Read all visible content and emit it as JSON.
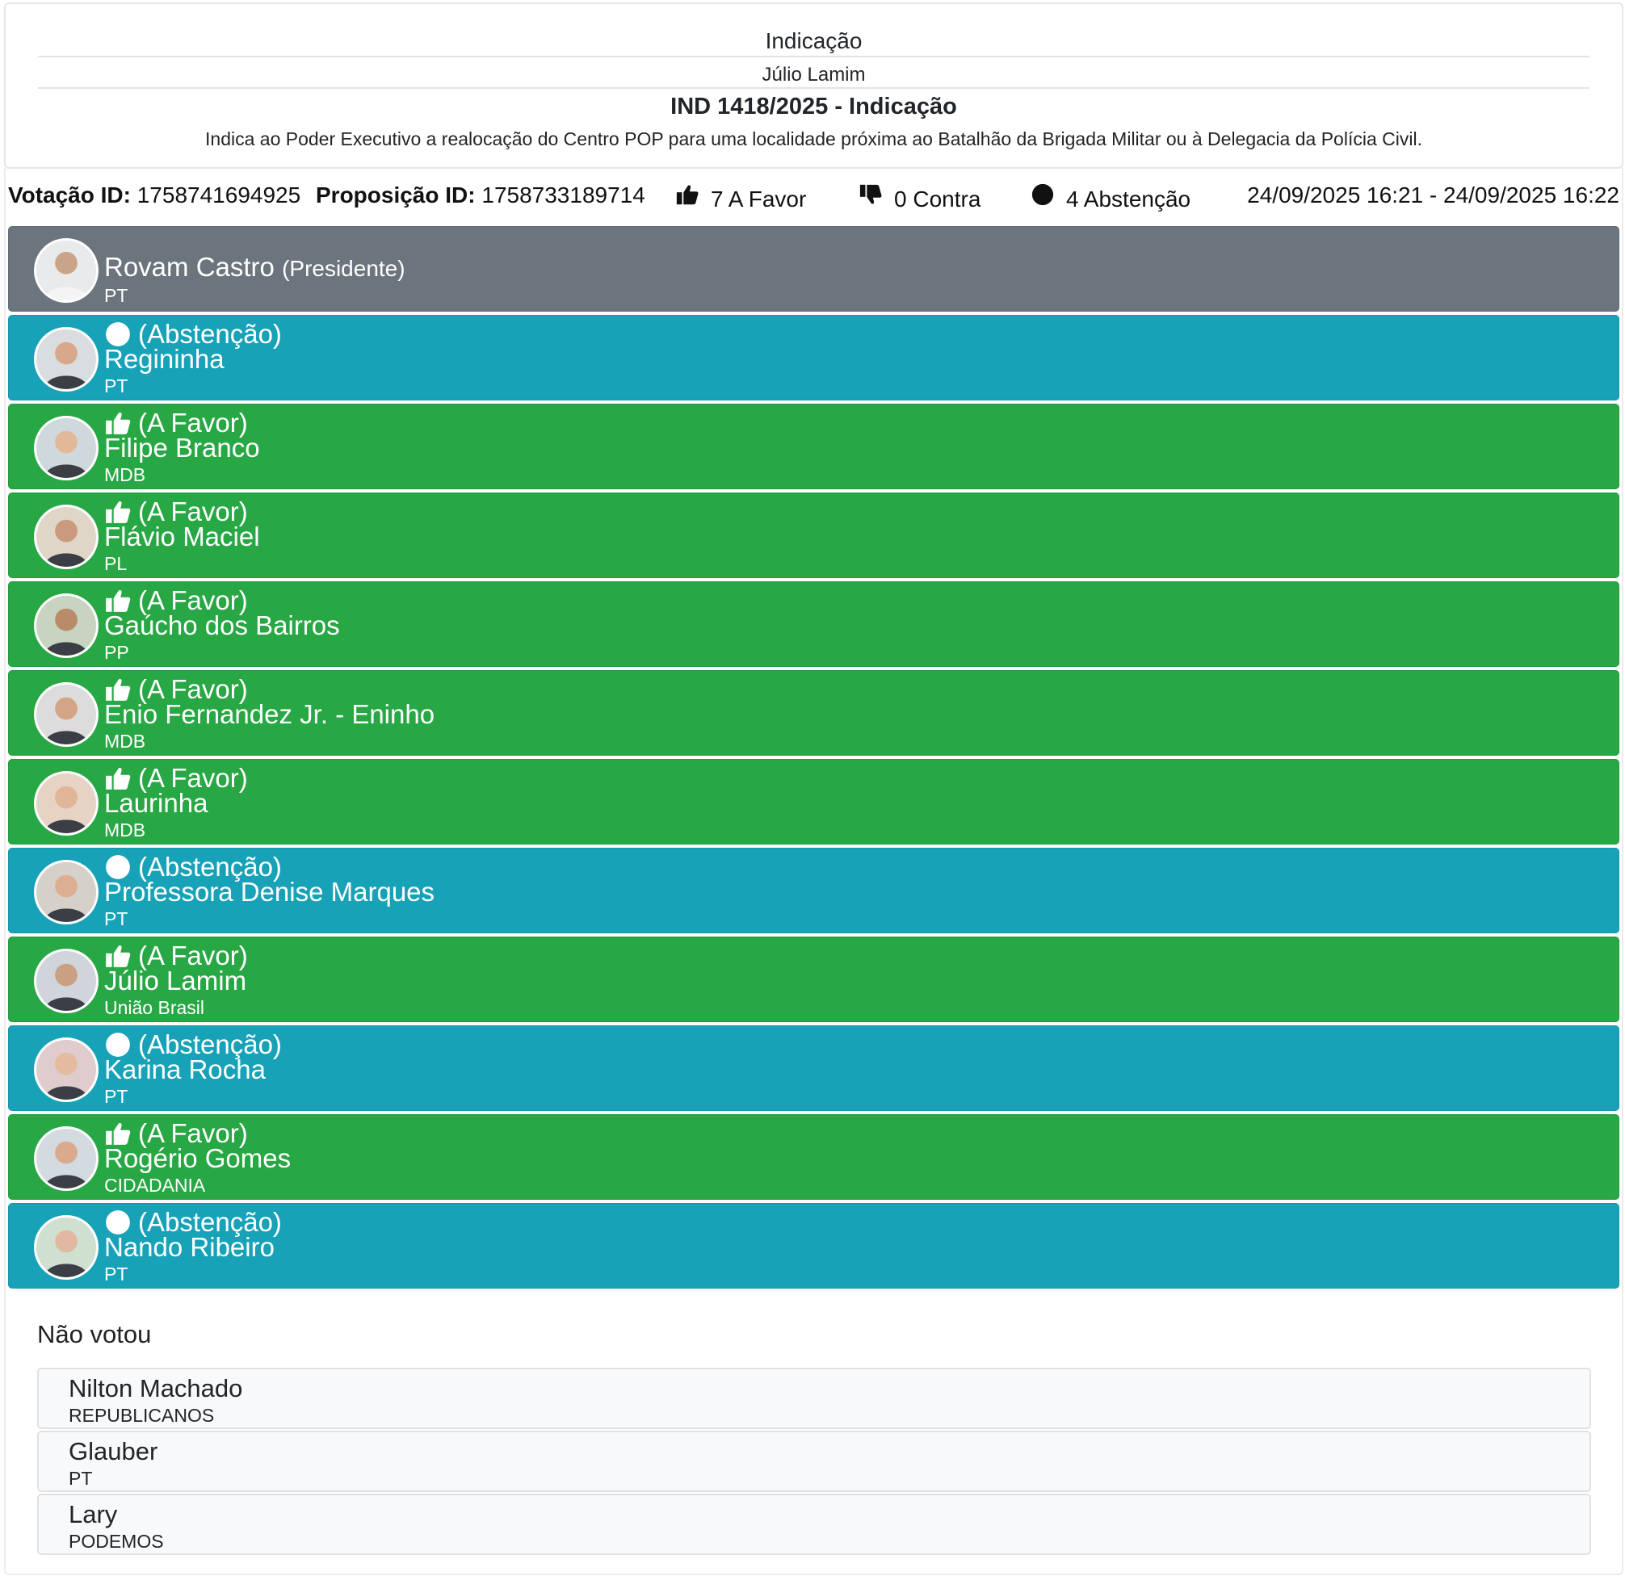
{
  "header": {
    "type": "Indicação",
    "author": "Júlio Lamim",
    "title": "IND 1418/2025 - Indicação",
    "description": "Indica ao Poder Executivo a realocação do Centro POP para uma localidade próxima ao Batalhão da Brigada Militar ou à Delegacia da Polícia Civil."
  },
  "summary": {
    "votacao_label": "Votação ID:",
    "votacao_id": "1758741694925",
    "proposicao_label": "Proposição ID:",
    "proposicao_id": "1758733189714",
    "favor": "7 A Favor",
    "contra": "0 Contra",
    "abstencao": "4 Abstenção",
    "period": "24/09/2025 16:21 - 24/09/2025 16:22"
  },
  "president": {
    "name": "Rovam Castro",
    "role": "(Presidente)",
    "party": "PT"
  },
  "votes": [
    {
      "vote": "(Abstenção)",
      "name": "Regininha",
      "party": "PT"
    },
    {
      "vote": "(A Favor)",
      "name": "Filipe Branco",
      "party": "MDB"
    },
    {
      "vote": "(A Favor)",
      "name": "Flávio Maciel",
      "party": "PL"
    },
    {
      "vote": "(A Favor)",
      "name": "Gaúcho dos Bairros",
      "party": "PP"
    },
    {
      "vote": "(A Favor)",
      "name": "Enio Fernandez Jr. - Eninho",
      "party": "MDB"
    },
    {
      "vote": "(A Favor)",
      "name": "Laurinha",
      "party": "MDB"
    },
    {
      "vote": "(Abstenção)",
      "name": "Professora Denise Marques",
      "party": "PT"
    },
    {
      "vote": "(A Favor)",
      "name": "Júlio Lamim",
      "party": "União Brasil"
    },
    {
      "vote": "(Abstenção)",
      "name": "Karina Rocha",
      "party": "PT"
    },
    {
      "vote": "(A Favor)",
      "name": "Rogério Gomes",
      "party": "CIDADANIA"
    },
    {
      "vote": "(Abstenção)",
      "name": "Nando Ribeiro",
      "party": "PT"
    }
  ],
  "not_voted": {
    "title": "Não votou",
    "items": [
      {
        "name": "Nilton Machado",
        "party": "REPUBLICANOS"
      },
      {
        "name": "Glauber",
        "party": "PT"
      },
      {
        "name": "Lary",
        "party": "PODEMOS"
      }
    ]
  },
  "colors": {
    "president": "#6c757d",
    "favor": "#28a745",
    "abstencao": "#17a2b8",
    "contra": "#dc3545"
  },
  "icons": {
    "favor": "thumbs-up-icon",
    "contra": "thumbs-down-icon",
    "abstencao": "circle-icon"
  }
}
